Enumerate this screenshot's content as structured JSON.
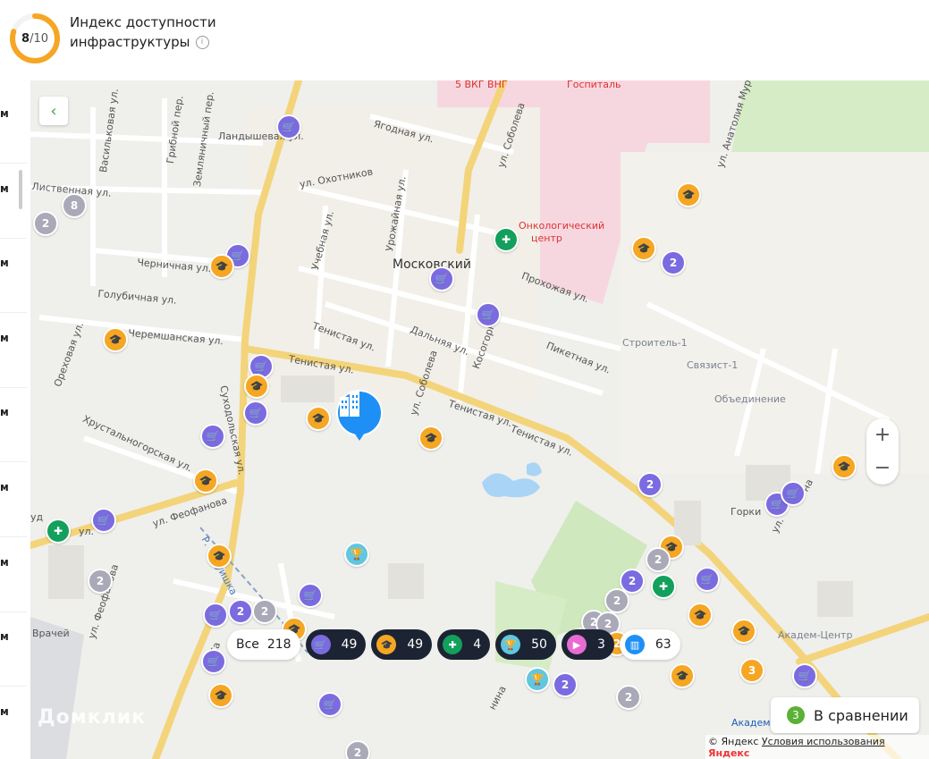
{
  "header": {
    "score_value": "8",
    "score_max": "/10",
    "title_line1": "Индекс доступности",
    "title_line2": "инфраструктуры",
    "info_icon": "info-icon"
  },
  "left_strip": {
    "units": [
      "м",
      "м",
      "м",
      "м",
      "м",
      "м",
      "м",
      "м",
      "м"
    ]
  },
  "map": {
    "labels": {
      "vkg": "5 ВКГ ВНГ",
      "hospital": "Госпиталь",
      "onko1": "Онкологический",
      "onko2": "центр",
      "district": "Московский",
      "stroitel": "Строитель-1",
      "svyazist": "Связист-1",
      "obedinenie": "Объединение",
      "gorki": "Горки",
      "akadem": "Академ-Центр",
      "akadem2": "Академ",
      "vrachey": "Врачей",
      "street_vasilk": "Васильковая ул.",
      "street_grib": "Грибной пер.",
      "street_zeml": "Земляничный пер.",
      "street_land": "Ландышевая ул.",
      "street_listv": "Лиственная ул.",
      "street_chern": "Черничная ул.",
      "street_golub": "Голубичная ул.",
      "street_cherem": "Черемшанская ул.",
      "street_oreh": "Ореховая ул.",
      "street_hrust": "Хрустальногорская ул.",
      "street_feof": "ул. Феофанова",
      "street_yagod": "Ягодная ул.",
      "street_ohot": "ул. Охотников",
      "street_urozh": "Урожайная ул.",
      "street_uchebn": "Учебная ул.",
      "street_tenist1": "Тенистая ул.",
      "street_tenist2": "Тенистая ул.",
      "street_tenist3": "Тенистая ул.",
      "street_tenist4": "Тенистая ул.",
      "street_dalnya": "Дальняя ул.",
      "street_kosog": "Косогорн.",
      "street_piket": "Пикетная ул.",
      "street_prohoz": "Прохожая ул.",
      "street_sobol1": "ул. Соболева",
      "street_sobol2": "ул. Соболева",
      "street_suhod": "Суходольская ул.",
      "street_anatol": "ул. Анатолия Мура",
      "street_rbaru": "Р. Баруишка",
      "street_feof2": "ул. Феофанова",
      "street_yl": "ул.",
      "street_ud": "уд",
      "street_sa": "ул. Сa",
      "street_nina": "нина",
      "street_na": "на",
      "street_g": "ул."
    },
    "pins": [
      {
        "type": "shop",
        "label": ""
      },
      {
        "type": "shop",
        "label": ""
      },
      {
        "type": "shop",
        "label": ""
      },
      {
        "type": "shop",
        "label": ""
      },
      {
        "type": "shop",
        "label": ""
      },
      {
        "type": "shop",
        "label": ""
      },
      {
        "type": "shop",
        "label": ""
      },
      {
        "type": "shop",
        "label": ""
      },
      {
        "type": "shop",
        "label": ""
      },
      {
        "type": "shop",
        "label": ""
      },
      {
        "type": "shop",
        "label": ""
      },
      {
        "type": "shop",
        "label": ""
      },
      {
        "type": "shop",
        "label": ""
      },
      {
        "type": "shop",
        "label": ""
      },
      {
        "type": "shop",
        "label": ""
      },
      {
        "type": "shop",
        "label": ""
      },
      {
        "type": "edu",
        "label": ""
      },
      {
        "type": "edu",
        "label": ""
      },
      {
        "type": "edu",
        "label": ""
      },
      {
        "type": "edu",
        "label": ""
      },
      {
        "type": "edu",
        "label": ""
      },
      {
        "type": "edu",
        "label": ""
      },
      {
        "type": "edu",
        "label": ""
      },
      {
        "type": "edu",
        "label": ""
      },
      {
        "type": "edu",
        "label": ""
      },
      {
        "type": "edu",
        "label": ""
      },
      {
        "type": "edu",
        "label": ""
      },
      {
        "type": "edu",
        "label": ""
      },
      {
        "type": "edu",
        "label": ""
      },
      {
        "type": "edu",
        "label": ""
      },
      {
        "type": "edu",
        "label": ""
      },
      {
        "type": "med",
        "label": ""
      },
      {
        "type": "med",
        "label": ""
      },
      {
        "type": "med",
        "label": ""
      },
      {
        "type": "sport",
        "label": ""
      },
      {
        "type": "sport",
        "label": ""
      },
      {
        "type": "clus",
        "label": "2"
      },
      {
        "type": "clus",
        "label": "8"
      },
      {
        "type": "clusv",
        "label": "2"
      },
      {
        "type": "clusv",
        "label": "2"
      },
      {
        "type": "clus",
        "label": "2"
      },
      {
        "type": "clusv",
        "label": "2"
      },
      {
        "type": "clus",
        "label": "2"
      },
      {
        "type": "clusv",
        "label": "2"
      },
      {
        "type": "clus",
        "label": "2"
      },
      {
        "type": "clus",
        "label": "2"
      },
      {
        "type": "clus",
        "label": "2"
      },
      {
        "type": "clus",
        "label": "2"
      },
      {
        "type": "cluso",
        "label": "2"
      },
      {
        "type": "cluso",
        "label": "3"
      },
      {
        "type": "clusv",
        "label": "2"
      },
      {
        "type": "clus",
        "label": "2"
      },
      {
        "type": "clus",
        "label": "2"
      }
    ],
    "watermark": "Домклик"
  },
  "filters": {
    "all_label": "Все",
    "all_count": "218",
    "items": [
      {
        "name": "shops",
        "count": "49",
        "color": "#7b6be0",
        "icon": "cart-icon"
      },
      {
        "name": "education",
        "count": "49",
        "color": "#f5a623",
        "icon": "graduation-icon"
      },
      {
        "name": "medicine",
        "count": "4",
        "color": "#12a05c",
        "icon": "cross-icon"
      },
      {
        "name": "sport",
        "count": "50",
        "color": "#62c6e0",
        "icon": "trophy-icon"
      },
      {
        "name": "entertainment",
        "count": "3",
        "color": "#e86bd3",
        "icon": "camera-icon"
      },
      {
        "name": "buildings",
        "count": "63",
        "color": "#1e90f5",
        "icon": "building-icon"
      }
    ]
  },
  "compare": {
    "badge": "3",
    "label": "В сравнении"
  },
  "copyright": {
    "prefix": "© Яндекс",
    "terms": "Условия использования",
    "brand": "Яндекс"
  },
  "colors": {
    "score": "#f5a623",
    "home": "#1e90f5",
    "back_arrow": "#4aa84a"
  }
}
